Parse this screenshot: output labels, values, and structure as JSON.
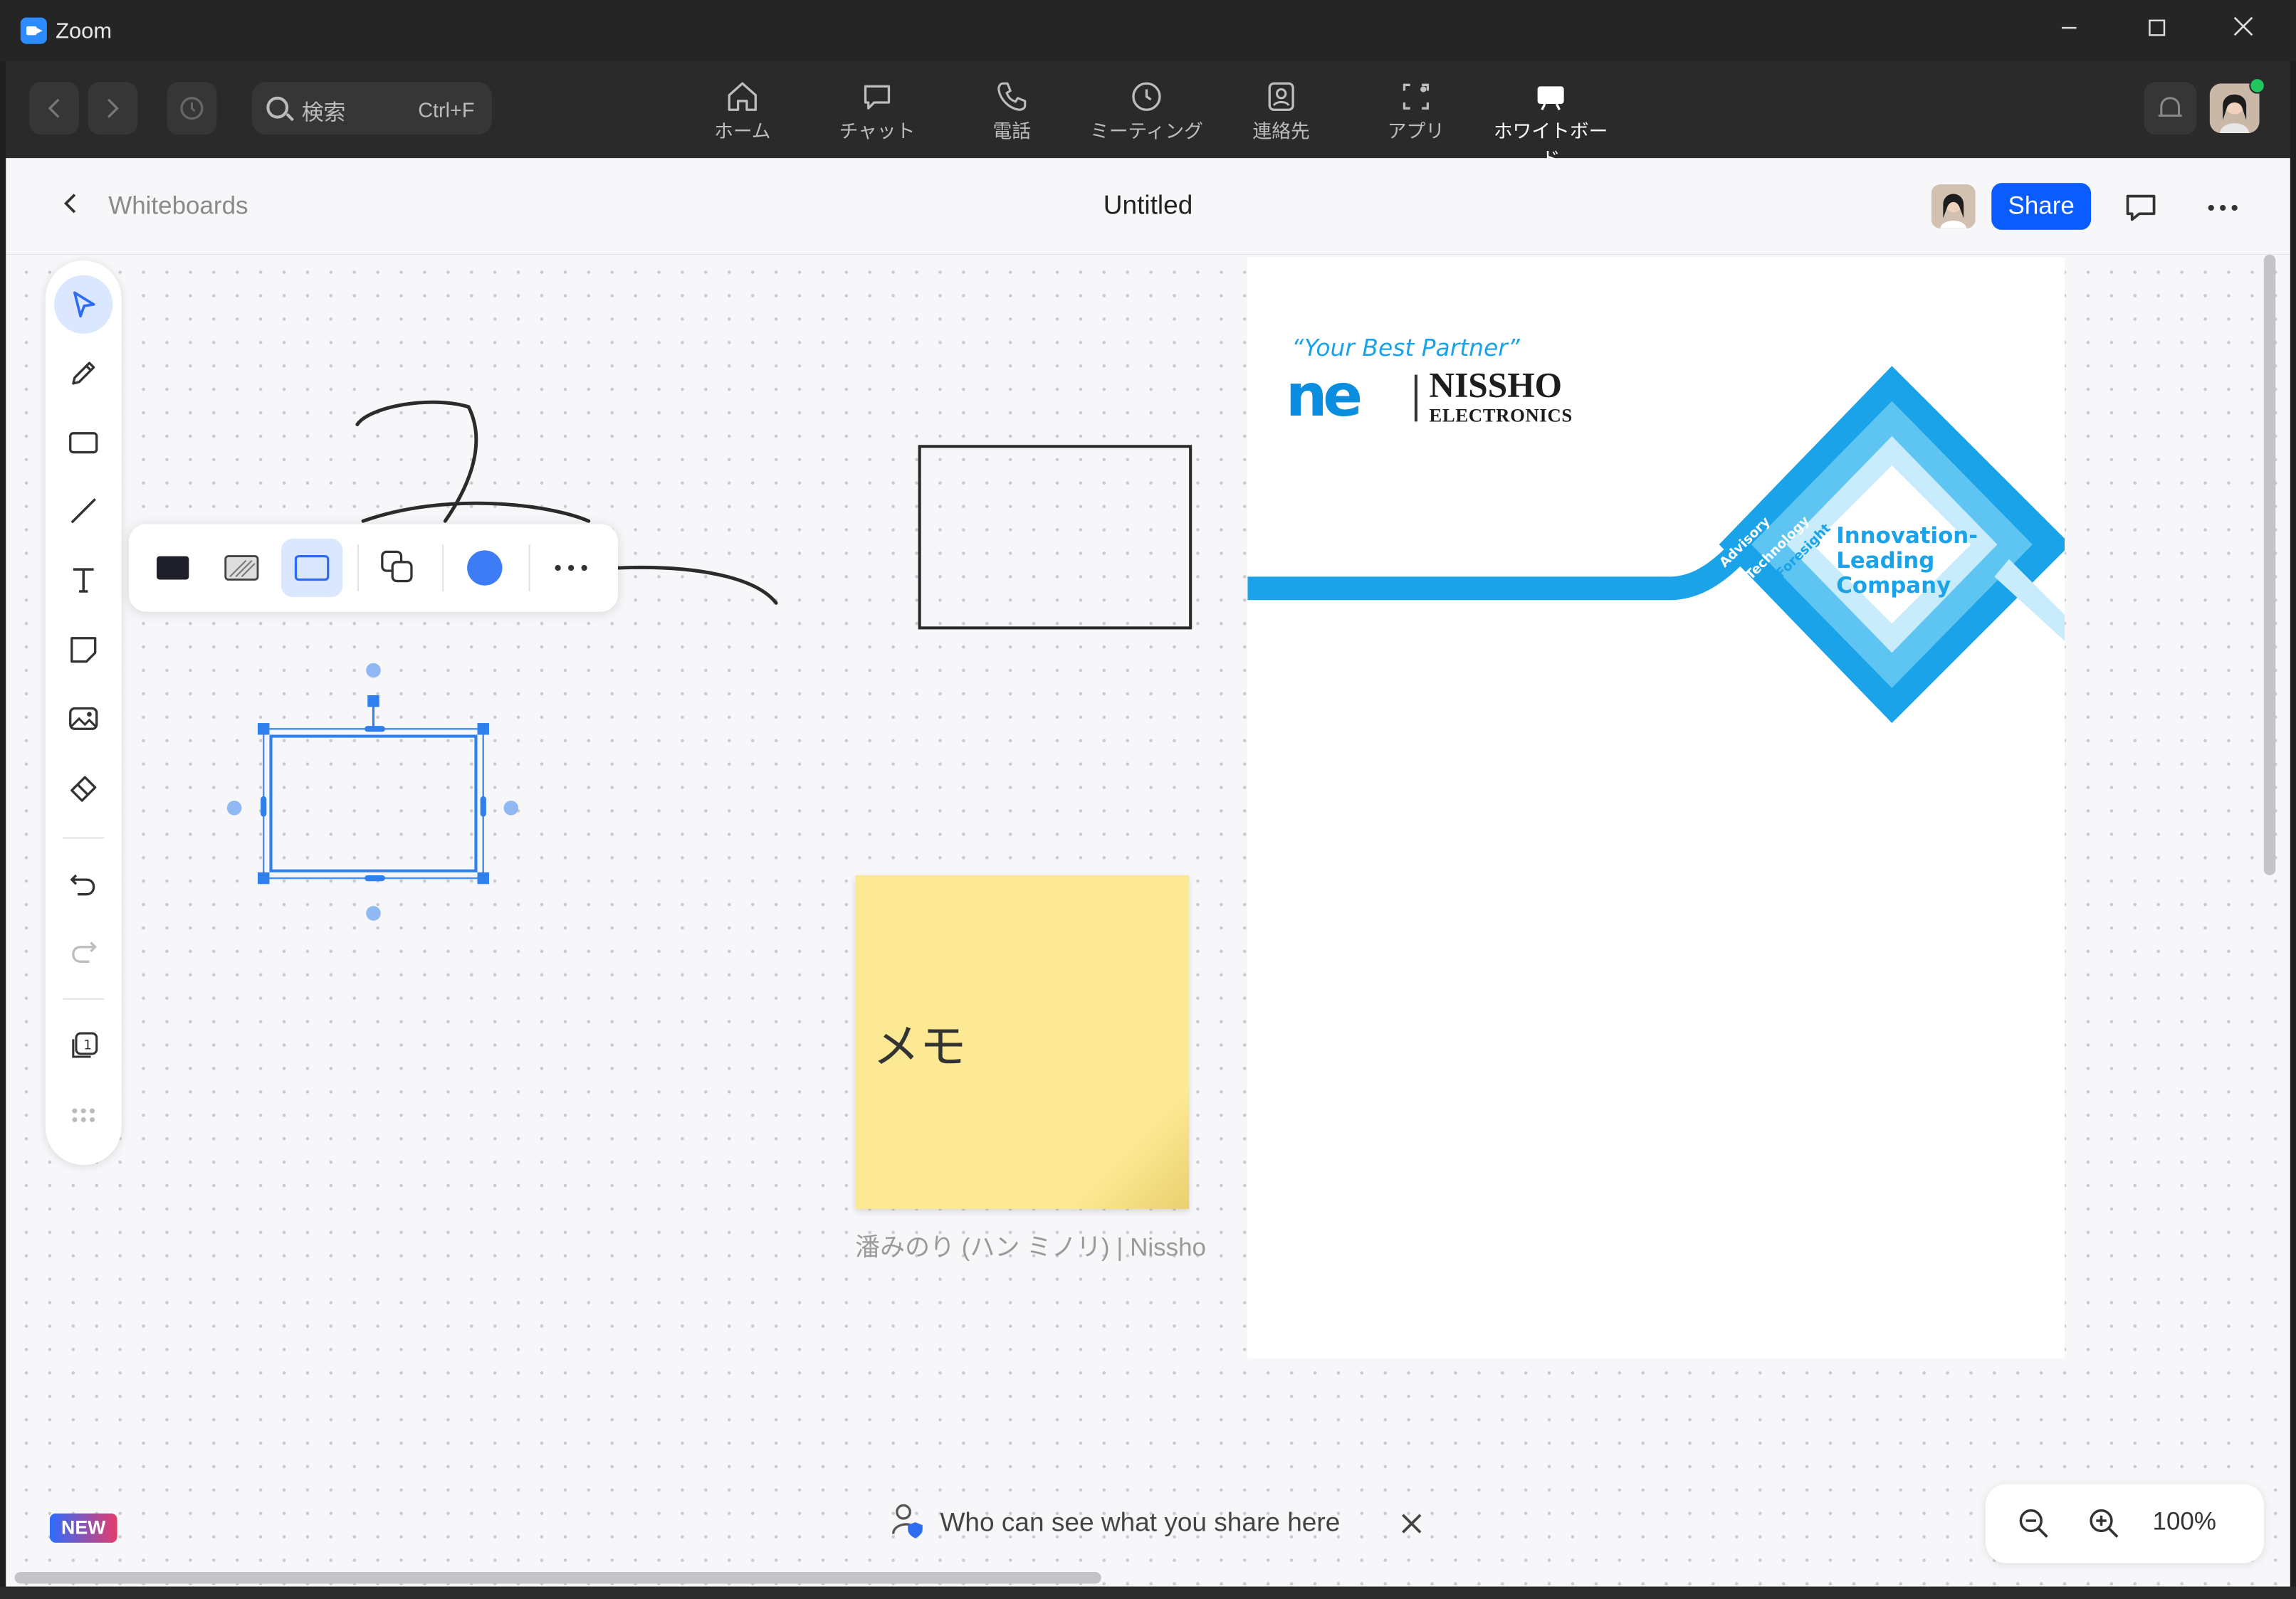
{
  "window": {
    "title": "Zoom"
  },
  "nav": {
    "search_label": "検索",
    "search_shortcut": "Ctrl+F",
    "tabs": [
      {
        "label": "ホーム",
        "icon": "home-icon"
      },
      {
        "label": "チャット",
        "icon": "chat-icon"
      },
      {
        "label": "電話",
        "icon": "phone-icon"
      },
      {
        "label": "ミーティング",
        "icon": "clock-icon"
      },
      {
        "label": "連絡先",
        "icon": "contacts-icon"
      },
      {
        "label": "アプリ",
        "icon": "apps-icon"
      },
      {
        "label": "ホワイトボード",
        "icon": "whiteboard-icon",
        "active": true
      }
    ]
  },
  "header": {
    "breadcrumb": "Whiteboards",
    "title": "Untitled",
    "share_label": "Share"
  },
  "toolbar": {
    "tools": [
      "select-tool",
      "pen-tool",
      "rectangle-tool",
      "line-tool",
      "text-tool",
      "sticky-note-tool",
      "image-tool",
      "eraser-tool",
      "undo",
      "redo",
      "pages",
      "more-tools"
    ]
  },
  "context_toolbar": {
    "fill_color": "#1f1f29",
    "stroke_color": "#3d7cf5"
  },
  "document": {
    "slogan": "“Your Best Partner”",
    "company": "NISSHO",
    "company_sub": "ELECTRONICS",
    "diamond_words": [
      "Advisory",
      "Technology",
      "Foresight"
    ],
    "tagline": [
      "Innovation-",
      "Leading",
      "Company"
    ]
  },
  "sticky_note": {
    "text": "メモ",
    "author": "潘みのり (ハン ミノリ) | Nissho"
  },
  "footer": {
    "new_badge": "NEW",
    "visibility_notice": "Who can see what you share here",
    "zoom_level": "100%"
  },
  "colors": {
    "accent": "#0b5cff",
    "brand_blue": "#1aa3e8",
    "sticky": "#fde993"
  }
}
